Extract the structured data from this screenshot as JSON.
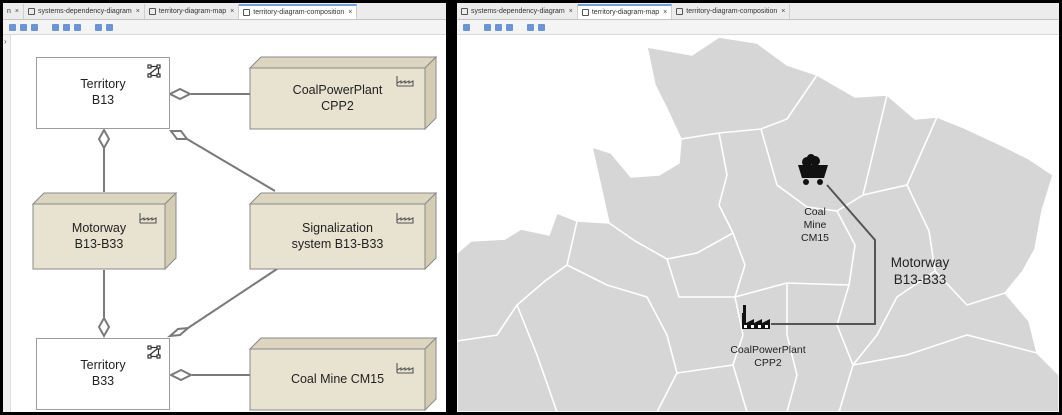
{
  "left_panel": {
    "tabs": [
      {
        "label": "n",
        "icon": "diagram-tab-icon",
        "active": false
      },
      {
        "label": "systems-dependency-diagram",
        "icon": "diagram-tab-icon",
        "active": false
      },
      {
        "label": "territory-diagram-map",
        "icon": "diagram-tab-icon",
        "active": false
      },
      {
        "label": "territory-diagram-composition",
        "icon": "diagram-tab-icon",
        "active": true
      }
    ],
    "tab_close": "×",
    "gutter_arrow": "›",
    "nodes": {
      "territory_b13": {
        "line1": "Territory",
        "line2": "B13",
        "icon": "territory-icon"
      },
      "territory_b33": {
        "line1": "Territory",
        "line2": "B33",
        "icon": "territory-icon"
      },
      "coal_power_plant": {
        "line1": "CoalPowerPlant",
        "line2": "CPP2",
        "icon": "factory-icon"
      },
      "motorway": {
        "line1": "Motorway",
        "line2": "B13-B33",
        "icon": "factory-icon"
      },
      "signalization": {
        "line1": "Signalization",
        "line2": "system B13-B33",
        "icon": "factory-icon"
      },
      "coal_mine": {
        "line1": "Coal Mine CM15",
        "icon": "factory-icon"
      }
    }
  },
  "right_panel": {
    "tabs": [
      {
        "label": "systems-dependency-diagram",
        "icon": "diagram-tab-icon",
        "active": false
      },
      {
        "label": "territory-diagram-map",
        "icon": "diagram-tab-icon",
        "active": true
      },
      {
        "label": "territory-diagram-composition",
        "icon": "diagram-tab-icon",
        "active": false
      }
    ],
    "tab_close": "×",
    "map": {
      "coal_mine": {
        "line1": "Coal",
        "line2": "Mine",
        "line3": "CM15",
        "icon": "mine-cart-icon"
      },
      "motorway": {
        "line1": "Motorway",
        "line2": "B13-B33"
      },
      "power_plant": {
        "line1": "CoalPowerPlant",
        "line2": "CPP2",
        "icon": "factory-icon"
      }
    }
  },
  "colors": {
    "equipment_fill": "#e8e3d0",
    "equipment_side": "#d4cdb4",
    "map_fill": "#d6d6d6",
    "map_borders": "#ffffff",
    "connector": "#7a7a7a"
  }
}
